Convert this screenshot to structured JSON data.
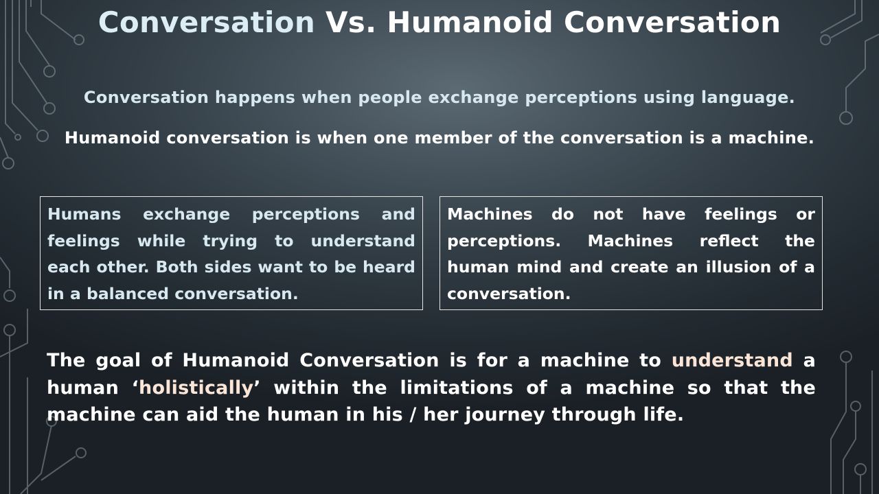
{
  "title": {
    "part1": "Conversation",
    "part2": "Vs. Humanoid Conversation"
  },
  "definitions": {
    "conversation": "Conversation happens when people exchange perceptions using language.",
    "humanoid": "Humanoid  conversation is when one member of the conversation is a machine."
  },
  "boxes": {
    "humans": "Humans exchange perceptions and feelings while trying to understand each other. Both sides want to be heard in a balanced conversation.",
    "machines": "Machines do not have feelings or perceptions. Machines reflect the human mind and create an illusion of a conversation."
  },
  "goal": {
    "seg1": "The goal of Humanoid Conversation is for a machine to ",
    "highlight1": "understand",
    "seg2": " a human ‘",
    "highlight2": "holistically",
    "seg3": "’ within the limitations of a machine so that the machine can aid the human in his / her journey through life."
  },
  "colors": {
    "background_center": "#5c6a73",
    "background_edge": "#1a2026",
    "text_light_blue": "#d8e8f0",
    "text_white": "#ffffff",
    "highlight": "#fbe5d6",
    "box_border": "#e6e6e6",
    "circuit_lines": "#8a969e"
  }
}
